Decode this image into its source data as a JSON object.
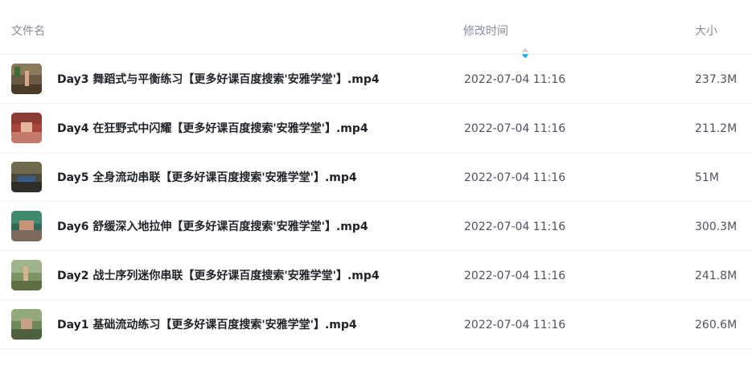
{
  "header": {
    "name_label": "文件名",
    "time_label": "修改时间",
    "size_label": "大小",
    "sort_icon": "sort-icon",
    "sort_colors": {
      "up": "#c9ccd4",
      "down": "#06a7ff"
    }
  },
  "files": [
    {
      "name": "Day3 舞蹈式与平衡练习【更多好课百度搜索'安雅学堂'】.mp4",
      "modified": "2022-07-04 11:16",
      "size": "237.3M",
      "thumb_icon": "video-thumbnail-icon"
    },
    {
      "name": "Day4 在狂野式中闪耀【更多好课百度搜索'安雅学堂'】.mp4",
      "modified": "2022-07-04 11:16",
      "size": "211.2M",
      "thumb_icon": "video-thumbnail-icon"
    },
    {
      "name": "Day5 全身流动串联【更多好课百度搜索'安雅学堂'】.mp4",
      "modified": "2022-07-04 11:16",
      "size": "51M",
      "thumb_icon": "video-thumbnail-icon"
    },
    {
      "name": "Day6 舒缓深入地拉伸【更多好课百度搜索'安雅学堂'】.mp4",
      "modified": "2022-07-04 11:16",
      "size": "300.3M",
      "thumb_icon": "video-thumbnail-icon"
    },
    {
      "name": "Day2 战士序列迷你串联【更多好课百度搜索'安雅学堂'】.mp4",
      "modified": "2022-07-04 11:16",
      "size": "241.8M",
      "thumb_icon": "video-thumbnail-icon"
    },
    {
      "name": "Day1 基础流动练习【更多好课百度搜索'安雅学堂'】.mp4",
      "modified": "2022-07-04 11:16",
      "size": "260.6M",
      "thumb_icon": "video-thumbnail-icon"
    }
  ]
}
